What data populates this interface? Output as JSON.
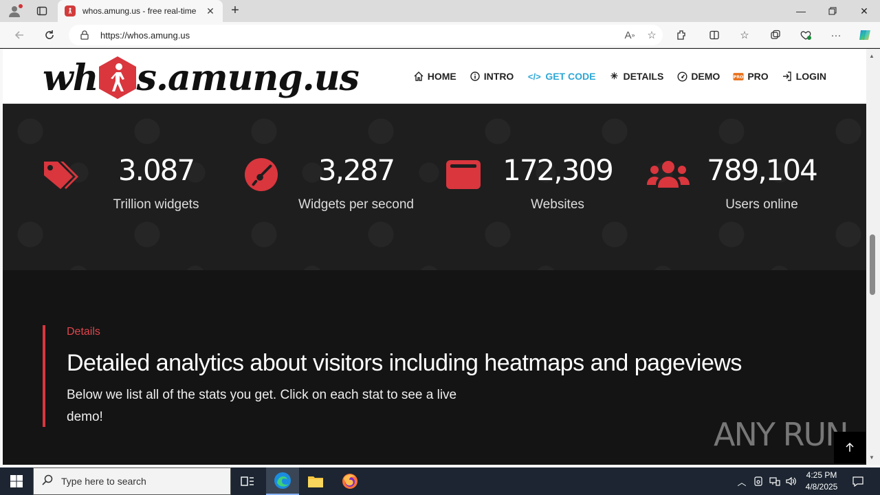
{
  "browser": {
    "tab_title": "whos.amung.us - free real-time",
    "url": "https://whos.amung.us"
  },
  "site": {
    "logo_text_left": "wh",
    "logo_text_right": "s.amung.us",
    "menu": [
      {
        "label": "HOME",
        "icon": "home-icon"
      },
      {
        "label": "INTRO",
        "icon": "info-icon"
      },
      {
        "label": "GET CODE",
        "icon": "code-icon",
        "active": true
      },
      {
        "label": "DETAILS",
        "icon": "asterisk-icon"
      },
      {
        "label": "DEMO",
        "icon": "dashboard-icon"
      },
      {
        "label": "PRO",
        "icon": "pro-badge-icon"
      },
      {
        "label": "LOGIN",
        "icon": "login-icon"
      }
    ]
  },
  "stats": [
    {
      "value": "3.087",
      "label": "Trillion widgets",
      "icon": "tags-icon"
    },
    {
      "value": "3,287",
      "label": "Widgets per second",
      "icon": "speedometer-icon"
    },
    {
      "value": "172,309",
      "label": "Websites",
      "icon": "browser-window-icon"
    },
    {
      "value": "789,104",
      "label": "Users online",
      "icon": "users-icon"
    }
  ],
  "details": {
    "kicker": "Details",
    "heading": "Detailed analytics about visitors including heatmaps and pageviews",
    "description": "Below we list all of the stats you get. Click on each stat to see a live demo!"
  },
  "watermark": "ANY RUN",
  "taskbar": {
    "search_placeholder": "Type here to search",
    "time": "4:25 PM",
    "date": "4/8/2025"
  },
  "colors": {
    "accent_red": "#d9363e",
    "active_link": "#2da7d6"
  }
}
